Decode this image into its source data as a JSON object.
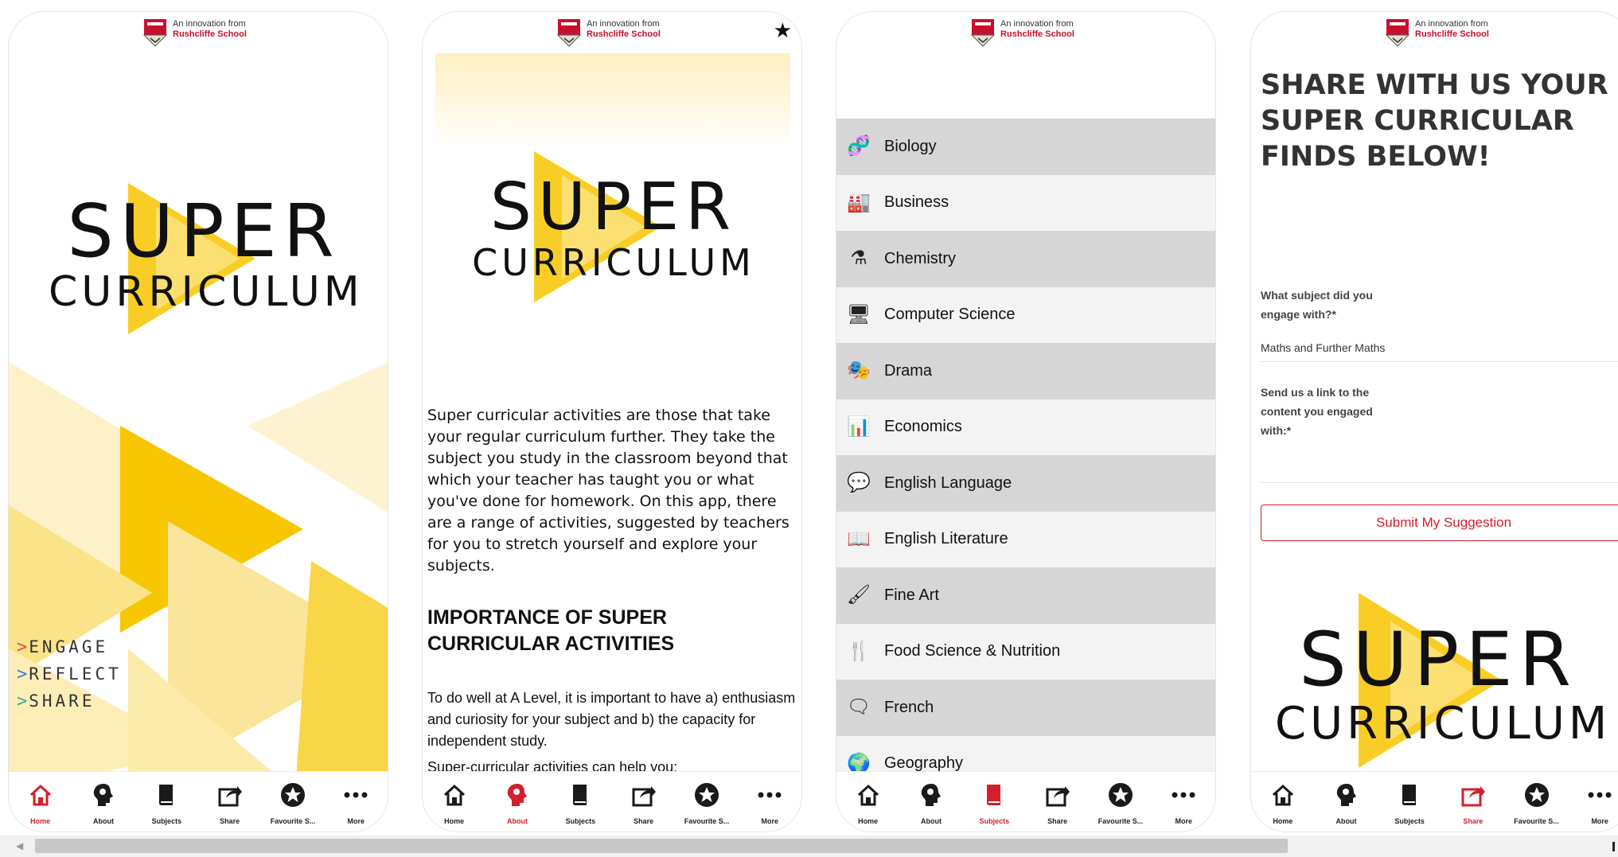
{
  "header": {
    "line1": "An innovation from",
    "line2": "Rushcliffe School"
  },
  "colors": {
    "accent": "#d41f2c",
    "yellow": "#f7c600",
    "list_dark": "#d6d6d6",
    "list_light": "#f3f3f3"
  },
  "logo": {
    "line1": "SUPER",
    "line2": "CURRICULUM"
  },
  "tabs": [
    {
      "label": "Home",
      "icon": "home-icon"
    },
    {
      "label": "About",
      "icon": "brain-icon"
    },
    {
      "label": "Subjects",
      "icon": "book-icon"
    },
    {
      "label": "Share",
      "icon": "share-icon"
    },
    {
      "label": "Favourite S...",
      "icon": "star-icon"
    },
    {
      "label": "More",
      "icon": "more-icon"
    }
  ],
  "home": {
    "taglines": [
      {
        "text": "ENGAGE",
        "color": "#d9534f"
      },
      {
        "text": "REFLECT",
        "color": "#3a7bd5"
      },
      {
        "text": "SHARE",
        "color": "#3aaa8c"
      }
    ],
    "active_tab": 0
  },
  "about": {
    "intro": "Super curricular activities are those that take your regular curriculum further. They take the subject you study in the classroom beyond that which your teacher has taught you or what you've done for homework. On this app, there are a range of activities, suggested by teachers for you to stretch yourself and explore your subjects.",
    "heading": "IMPORTANCE OF SUPER CURRICULAR ACTIVITIES",
    "para2": "To do well at A Level, it is important to have a) enthusiasm and curiosity for your subject and b) the capacity for independent study.",
    "para3": "Super-curricular activities can help you:",
    "active_tab": 1
  },
  "subjects": {
    "items": [
      {
        "name": "Biology",
        "icon": "dna-icon",
        "glyph": "🧬"
      },
      {
        "name": "Business",
        "icon": "factory-icon",
        "glyph": "🏭"
      },
      {
        "name": "Chemistry",
        "icon": "flask-icon",
        "glyph": "⚗"
      },
      {
        "name": "Computer Science",
        "icon": "computer-icon",
        "glyph": "🖥"
      },
      {
        "name": "Drama",
        "icon": "theatre-masks-icon",
        "glyph": "🎭"
      },
      {
        "name": "Economics",
        "icon": "bar-chart-icon",
        "glyph": "📊"
      },
      {
        "name": "English Language",
        "icon": "speech-bubble-icon",
        "glyph": "💬"
      },
      {
        "name": "English Literature",
        "icon": "open-book-icon",
        "glyph": "📖"
      },
      {
        "name": "Fine Art",
        "icon": "paintbrush-icon",
        "glyph": "🖌"
      },
      {
        "name": "Food Science & Nutrition",
        "icon": "cutlery-icon",
        "glyph": "🍴"
      },
      {
        "name": "French",
        "icon": "chat-bubbles-icon",
        "glyph": "🗨"
      },
      {
        "name": "Geography",
        "icon": "globe-icon",
        "glyph": "🌍"
      }
    ],
    "active_tab": 2
  },
  "share": {
    "heading": "SHARE WITH US YOUR SUPER CURRICULAR FINDS BELOW!",
    "q1": "What subject did you engage with?*",
    "q1_value": "Maths and Further Maths",
    "q2": "Send us a link to the content you engaged with:*",
    "submit": "Submit My Suggestion",
    "active_tab": 3
  }
}
